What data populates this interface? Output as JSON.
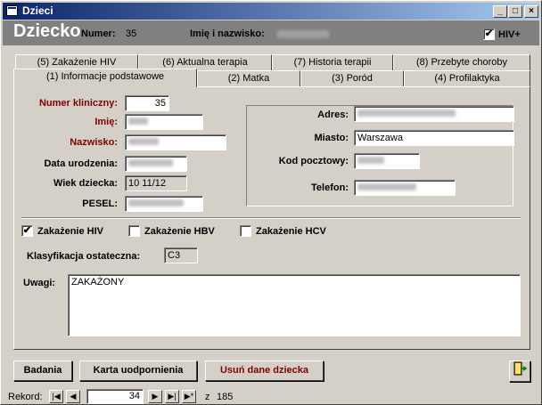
{
  "window": {
    "title": "Dzieci"
  },
  "header": {
    "heading": "Dziecko",
    "numer_label": "Numer:",
    "numer_value": "35",
    "name_label": "Imię i nazwisko:",
    "hiv_label": "HIV+",
    "hiv_checked": "✔"
  },
  "tabs": {
    "row1": [
      "(5) Zakażenie HIV",
      "(6) Aktualna terapia",
      "(7) Historia terapii",
      "(8) Przebyte choroby"
    ],
    "row2": [
      "(1) Informacje podstawowe",
      "(2) Matka",
      "(3) Poród",
      "(4) Profilaktyka"
    ]
  },
  "form": {
    "numer_kliniczny_label": "Numer kliniczny:",
    "numer_kliniczny_value": "35",
    "imie_label": "Imię:",
    "nazwisko_label": "Nazwisko:",
    "data_urodzenia_label": "Data urodzenia:",
    "wiek_label": "Wiek dziecka:",
    "wiek_value": "10 11/12",
    "pesel_label": "PESEL:",
    "adres_label": "Adres:",
    "miasto_label": "Miasto:",
    "miasto_value": "Warszawa",
    "kod_label": "Kod pocztowy:",
    "telefon_label": "Telefon:",
    "hiv_label": "Zakażenie HIV",
    "hiv_mark": "✔",
    "hbv_label": "Zakażenie HBV",
    "hcv_label": "Zakażenie HCV",
    "klas_label": "Klasyfikacja ostateczna:",
    "klas_value": "C3",
    "uwagi_label": "Uwagi:",
    "uwagi_value": "ZAKAŻONY"
  },
  "buttons": {
    "badania": "Badania",
    "karta": "Karta uodpornienia",
    "usun": "Usuń dane dziecka"
  },
  "record_nav": {
    "label": "Rekord:",
    "current": "34",
    "of": "z",
    "total": "185"
  },
  "colors": {
    "title_start": "#0a246a",
    "title_end": "#a6caf0",
    "required_label": "#800000"
  }
}
